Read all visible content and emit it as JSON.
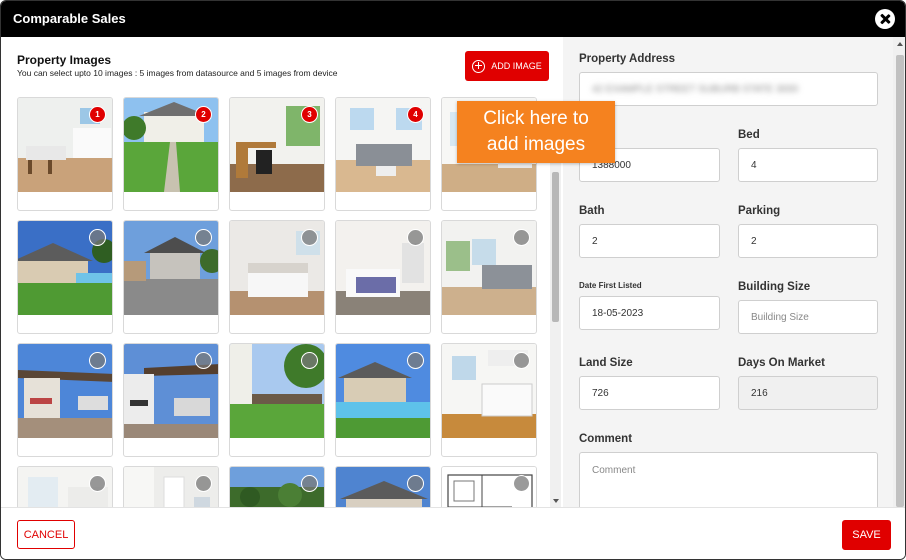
{
  "modal": {
    "title": "Comparable Sales"
  },
  "images": {
    "title": "Property Images",
    "subtitle": "You can select upto 10 images : 5 images from datasource and 5 images from device",
    "add_label": "ADD IMAGE",
    "callout": [
      "Click here to",
      "add images"
    ],
    "items": [
      {
        "badge": "1",
        "scene": "kitchen"
      },
      {
        "badge": "2",
        "scene": "yard-path"
      },
      {
        "badge": "3",
        "scene": "office"
      },
      {
        "badge": "4",
        "scene": "living"
      },
      {
        "badge": "",
        "scene": "room-bright"
      },
      {
        "badge": "",
        "scene": "house-pool"
      },
      {
        "badge": "",
        "scene": "driveway"
      },
      {
        "badge": "",
        "scene": "bedroom"
      },
      {
        "badge": "",
        "scene": "bedroom2"
      },
      {
        "badge": "",
        "scene": "lounge"
      },
      {
        "badge": "",
        "scene": "patio"
      },
      {
        "badge": "",
        "scene": "patio2"
      },
      {
        "badge": "",
        "scene": "side-lawn"
      },
      {
        "badge": "",
        "scene": "pool-house"
      },
      {
        "badge": "",
        "scene": "laundry"
      },
      {
        "badge": "",
        "scene": "interior-white"
      },
      {
        "badge": "",
        "scene": "hallway"
      },
      {
        "badge": "",
        "scene": "aerial"
      },
      {
        "badge": "",
        "scene": "roof-sky"
      },
      {
        "badge": "",
        "scene": "floorplan"
      }
    ]
  },
  "form": {
    "address_label": "Property Address",
    "address_value": "42 EXAMPLE STREET SUBURB STATE 3000",
    "price_value": "1388000",
    "bed_label": "Bed",
    "bed_value": "4",
    "bath_label": "Bath",
    "bath_value": "2",
    "parking_label": "Parking",
    "parking_value": "2",
    "date_label": "Date First Listed",
    "date_value": "18-05-2023",
    "building_label": "Building Size",
    "building_placeholder": "Building Size",
    "land_label": "Land Size",
    "land_value": "726",
    "dom_label": "Days On Market",
    "dom_value": "216",
    "comment_label": "Comment",
    "comment_placeholder": "Comment"
  },
  "footer": {
    "cancel_label": "CANCEL",
    "save_label": "SAVE"
  },
  "colors": {
    "accent": "#e00000",
    "callout": "#f5821f",
    "titlebar": "#000000"
  }
}
